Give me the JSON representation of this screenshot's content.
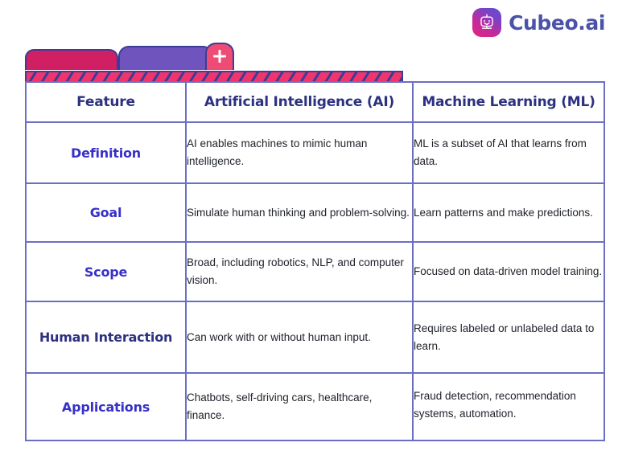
{
  "brand": {
    "name": "Cubeo.ai",
    "mark_icon": "robot-face-icon",
    "gradient_from": "#e8247e",
    "gradient_to": "#5b4fd0",
    "text_color": "#4a53a8"
  },
  "decoration": {
    "tab_one_color": "#d11f63",
    "tab_two_color": "#6f54bd",
    "add_tab_color": "#ef4c75",
    "add_tab_icon": "plus-icon",
    "outline_color": "#3b3d96",
    "striped_bar_color": "#f0356d"
  },
  "table": {
    "header_color": "#2c3180",
    "label_color": "#3730c8",
    "border_color": "#6a6fc4",
    "headers": [
      "Feature",
      "Artificial Intelligence (AI)",
      "Machine Learning (ML)"
    ],
    "rows": [
      {
        "feature": "Definition",
        "ai": "AI enables machines to mimic human intelligence.",
        "ml": "ML is a subset of AI that learns from data."
      },
      {
        "feature": "Goal",
        "ai": "Simulate human thinking and problem-solving.",
        "ml": "Learn patterns and make predictions."
      },
      {
        "feature": "Scope",
        "ai": "Broad, including robotics, NLP, and computer vision.",
        "ml": "Focused on data-driven model training."
      },
      {
        "feature": "Human Interaction",
        "ai": "Can work with or without human input.",
        "ml": "Requires labeled or unlabeled data to learn."
      },
      {
        "feature": "Applications",
        "ai": "Chatbots, self-driving cars, healthcare, finance.",
        "ml": "Fraud detection, recommendation systems, automation."
      }
    ]
  }
}
